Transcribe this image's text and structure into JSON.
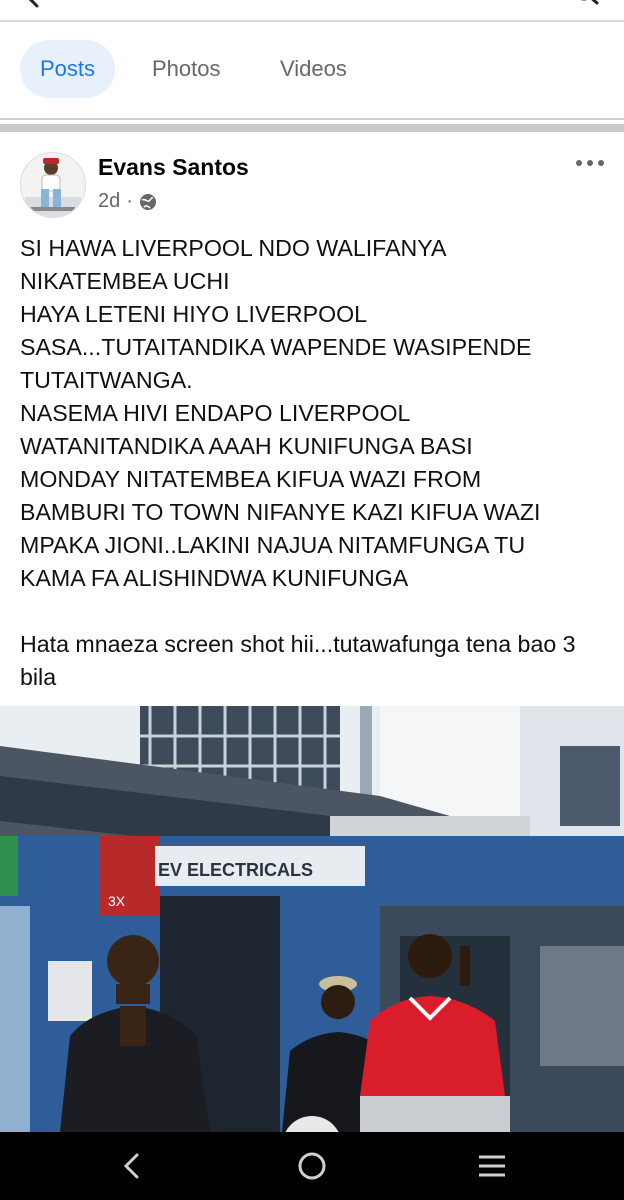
{
  "header": {
    "back_icon": "arrow-left-icon",
    "search_icon": "search-icon"
  },
  "tabs": [
    {
      "label": "Posts",
      "active": true
    },
    {
      "label": "Photos",
      "active": false
    },
    {
      "label": "Videos",
      "active": false
    }
  ],
  "post": {
    "author": "Evans Santos",
    "time": "2d",
    "separator": "·",
    "privacy_icon": "globe-icon",
    "more_icon": "more-horizontal-icon",
    "text_lines": [
      "SI HAWA LIVERPOOL NDO WALIFANYA",
      "NIKATEMBEA UCHI",
      "HAYA LETENI HIYO LIVERPOOL",
      "SASA...TUTAITANDIKA WAPENDE WASIPENDE",
      "TUTAITWANGA.",
      "NASEMA HIVI ENDAPO LIVERPOOL",
      "WATANITANDIKA AAAH KUNIFUNGA BASI",
      "MONDAY NITATEMBEA KIFUA WAZI FROM",
      "BAMBURI TO TOWN NIFANYE KAZI KIFUA WAZI",
      "MPAKA JIONI..LAKINI NAJUA NITAMFUNGA TU",
      "KAMA FA ALISHINDWA KUNIFUNGA"
    ],
    "text_footer": "Hata mnaeza screen shot hii...tutawafunga tena bao 3 bila",
    "photo": {
      "shop_sign": "EV ELECTRICALS",
      "poster_text": "3X"
    }
  },
  "navbar": {
    "back_icon": "nav-back-icon",
    "home_icon": "nav-home-icon",
    "recents_icon": "nav-recents-icon"
  },
  "colors": {
    "accent": "#1877f2",
    "tab_active_bg": "#e7f0fb",
    "muted": "#65676b",
    "shirt_red": "#d91d2a"
  }
}
